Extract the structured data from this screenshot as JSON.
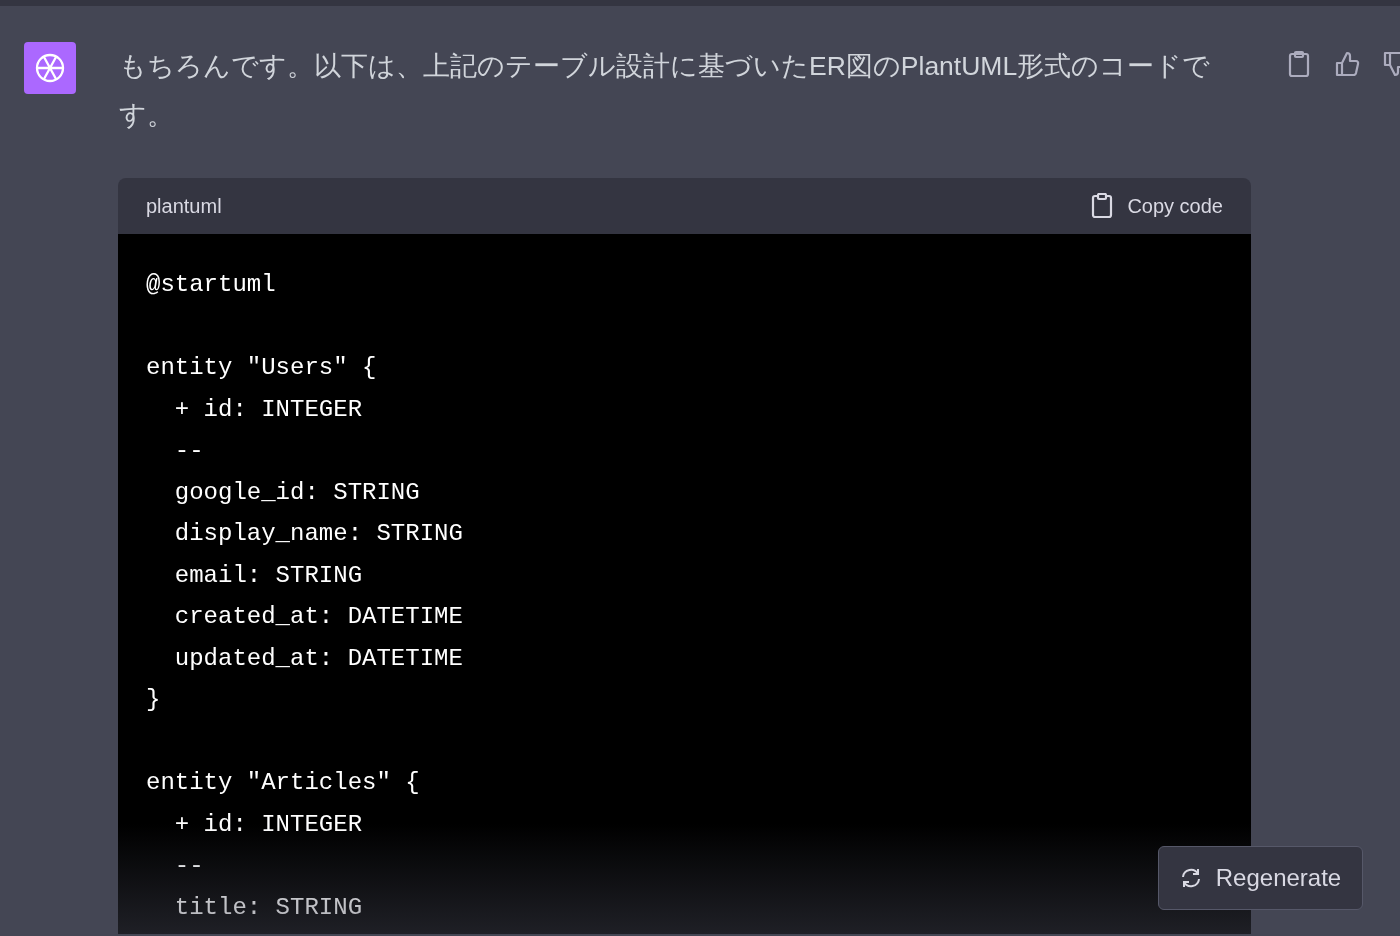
{
  "message": {
    "text": "もちろんです。以下は、上記のテーブル設計に基づいたER図のPlantUML形式のコードです。"
  },
  "code_block": {
    "language": "plantuml",
    "copy_label": "Copy code",
    "blocks": [
      [
        "@startuml"
      ],
      [
        "entity \"Users\" {",
        "  + id: INTEGER",
        "  --",
        "  google_id: STRING",
        "  display_name: STRING",
        "  email: STRING",
        "  created_at: DATETIME",
        "  updated_at: DATETIME",
        "}"
      ],
      [
        "entity \"Articles\" {",
        "  + id: INTEGER",
        "  --",
        "  title: STRING"
      ]
    ]
  },
  "regenerate_button": {
    "label": "Regenerate"
  }
}
